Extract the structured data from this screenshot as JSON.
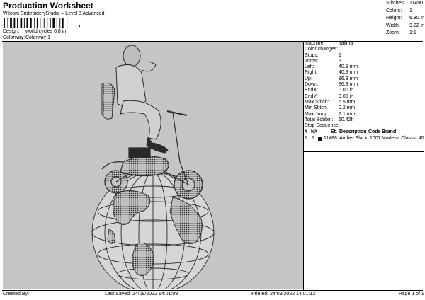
{
  "header": {
    "title": "Production Worksheet",
    "subtitle": "Wilcom EmbroideryStudio – Level 3 Advanced",
    "design_label": "Design:",
    "design_value": "world cycles 6,8 in",
    "colorway_label": "Colorway:",
    "colorway_value": "Colorway 1"
  },
  "stats": [
    {
      "label": "Stitches:",
      "value": "11490"
    },
    {
      "label": "Colors:",
      "value": "1"
    },
    {
      "label": "Height:",
      "value": "6.80 in"
    },
    {
      "label": "Width:",
      "value": "3.22 in"
    },
    {
      "label": "Zoom:",
      "value": "1:1"
    }
  ],
  "details": [
    {
      "label": "Machine:",
      "value": "Tajima"
    },
    {
      "label": "Color changes:",
      "value": "0"
    },
    {
      "label": "Stops:",
      "value": "1"
    },
    {
      "label": "Trims:",
      "value": "3"
    },
    {
      "label": "Left:",
      "value": "40.9 mm"
    },
    {
      "label": "Right:",
      "value": "40.9 mm"
    },
    {
      "label": "Up:",
      "value": "86.3 mm"
    },
    {
      "label": "Down:",
      "value": "86.3 mm"
    },
    {
      "label": "EndX:",
      "value": "0.00 in"
    },
    {
      "label": "EndY:",
      "value": "0.00 in"
    },
    {
      "label": "Max Stitch:",
      "value": "6.5 mm"
    },
    {
      "label": "Min Stitch:",
      "value": "0.2 mm"
    },
    {
      "label": "Max Jump:",
      "value": "7.1 mm"
    },
    {
      "label": "Total Bobbin:",
      "value": "60.42ft"
    }
  ],
  "stop_sequence": {
    "label": "Stop Sequence:",
    "columns": [
      "#",
      "N#",
      "St.",
      "Description",
      "Code",
      "Brand"
    ],
    "rows": [
      {
        "num": "1",
        "n": "1",
        "stitches": "11488",
        "description": "Amber Black",
        "code": "1007",
        "brand": "Madeira Classic 40",
        "color": "#111111"
      }
    ]
  },
  "footer": {
    "created_by": "Created By:",
    "last_saved": "Last Saved: 24/09/2022 14:01:09",
    "printed": "Printed: 24/09/2022 14:01:12",
    "page": "Page 1 of 1"
  },
  "colors": {
    "canvas_bg": "#c5c5c5",
    "thread": "#2a2a2a"
  }
}
